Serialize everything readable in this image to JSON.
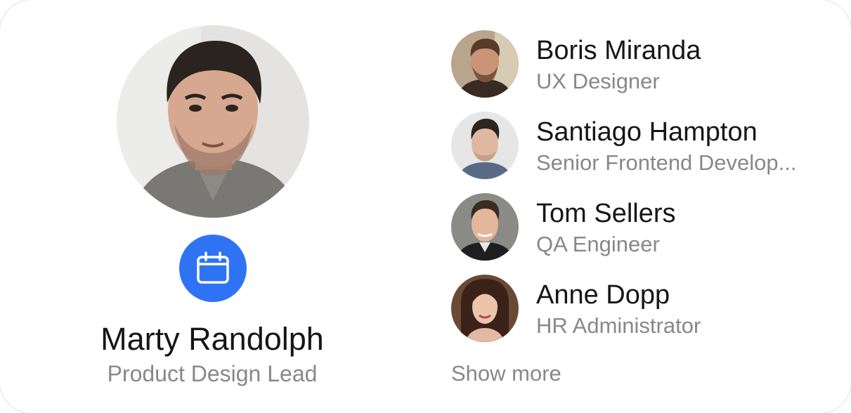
{
  "profile": {
    "name": "Marty Randolph",
    "role": "Product Design Lead",
    "action_icon": "calendar-icon",
    "accent_color": "#2f73f5"
  },
  "team": [
    {
      "name": "Boris Miranda",
      "role": "UX Designer"
    },
    {
      "name": "Santiago Hampton",
      "role": "Senior Frontend Develop..."
    },
    {
      "name": "Tom Sellers",
      "role": "QA Engineer"
    },
    {
      "name": "Anne Dopp",
      "role": "HR Administrator"
    }
  ],
  "show_more_label": "Show more"
}
